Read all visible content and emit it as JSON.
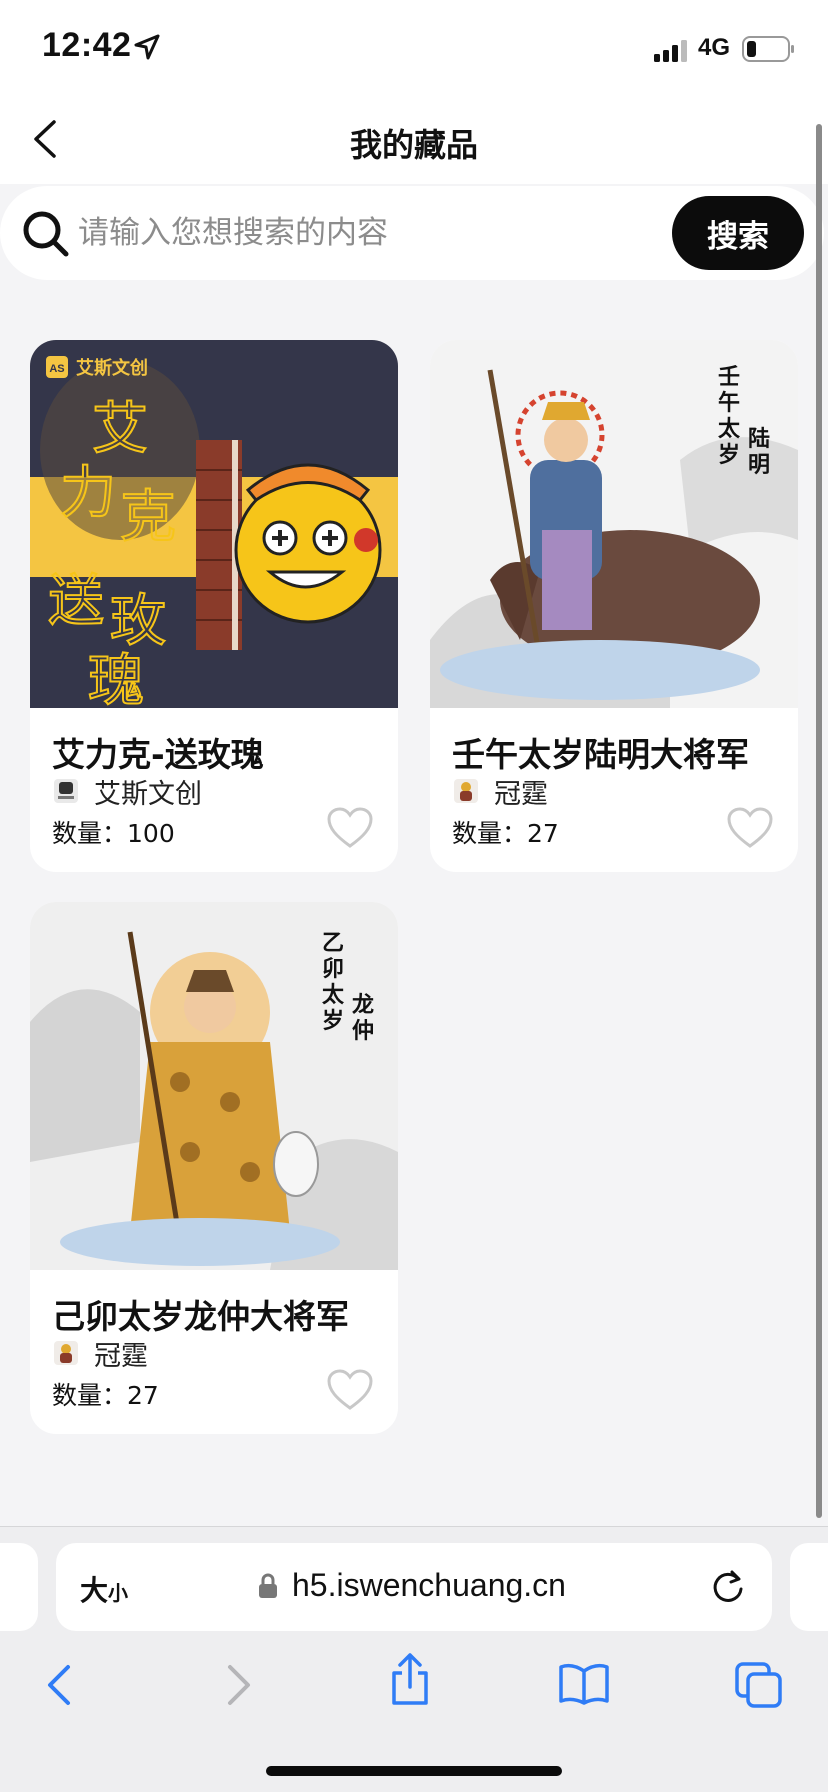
{
  "status_bar": {
    "time": "12:42",
    "network": "4G",
    "icons": [
      "location-arrow-icon",
      "signal-bars-icon",
      "battery-icon"
    ]
  },
  "nav": {
    "title": "我的藏品",
    "back_icon": "chevron-left-icon"
  },
  "search": {
    "placeholder": "请输入您想搜索的内容",
    "button_label": "搜索",
    "icon": "search-icon"
  },
  "cards": [
    {
      "title": "艾力克-送玫瑰",
      "creator": "艾斯文创",
      "quantity_label": "数量：",
      "quantity": "100",
      "image_text": [
        "艾",
        "力",
        "克",
        "送",
        "玫",
        "瑰"
      ],
      "logo_text": "艾斯文创",
      "logo_badge": "AS"
    },
    {
      "title": "壬午太岁陆明大将军",
      "creator": "冠霆",
      "quantity_label": "数量：",
      "quantity": "27",
      "image_text": [
        "壬",
        "午",
        "太",
        "岁",
        "陆",
        "明"
      ]
    },
    {
      "title": "己卯太岁龙仲大将军",
      "creator": "冠霆",
      "quantity_label": "数量：",
      "quantity": "27",
      "image_text": [
        "乙",
        "卯",
        "太",
        "岁",
        "龙",
        "仲"
      ]
    }
  ],
  "browser": {
    "text_size_big": "大",
    "text_size_small": "小",
    "url": "h5.iswenchuang.cn",
    "toolbar_icons": [
      "back-arrow-icon",
      "forward-arrow-icon",
      "share-icon",
      "bookmarks-icon",
      "tabs-icon"
    ]
  },
  "colors": {
    "page_background": "#f4f4f6",
    "search_button": "#0c0c0c",
    "card_background": "#ffffff",
    "browser_blue": "#2f7cf6"
  }
}
